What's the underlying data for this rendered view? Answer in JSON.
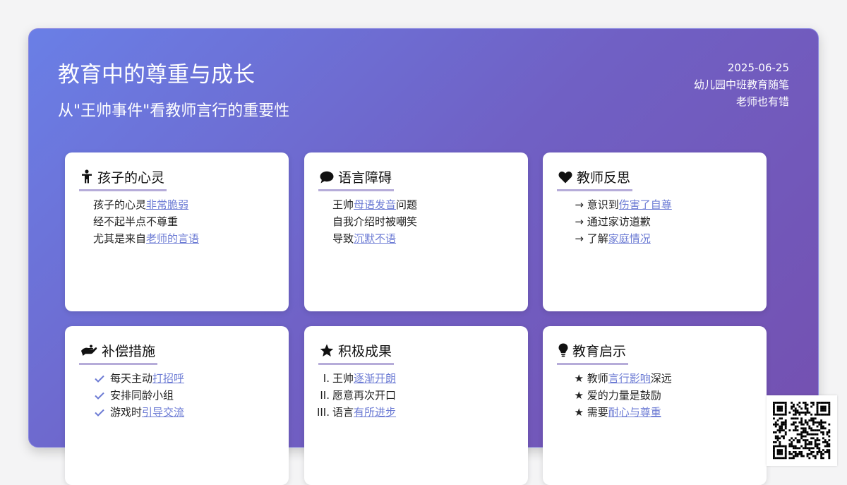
{
  "header": {
    "title": "教育中的尊重与成长",
    "subtitle": "从\"王帅事件\"看教师言行的重要性",
    "date": "2025-06-25",
    "category": "幼儿园中班教育随笔",
    "tag": "老师也有错"
  },
  "colors": {
    "gradient_start": "#6a7fe6",
    "gradient_end": "#7450b0",
    "highlight": "#6c7bd4",
    "underline": "#b6acd9"
  },
  "cards": [
    {
      "title": "孩子的心灵",
      "icon": "child-icon",
      "items": [
        {
          "lead": "",
          "pre": "孩子的心灵",
          "hl": "非常脆弱",
          "post": ""
        },
        {
          "lead": "",
          "pre": "经不起半点不尊重",
          "hl": "",
          "post": ""
        },
        {
          "lead": "",
          "pre": "尤其是来自",
          "hl": "老师的言语",
          "post": ""
        }
      ]
    },
    {
      "title": "语言障碍",
      "icon": "speech-bubble-icon",
      "items": [
        {
          "lead": "",
          "pre": "王帅",
          "hl": "母语发音",
          "post": "问题"
        },
        {
          "lead": "",
          "pre": "自我介绍时被嘲笑",
          "hl": "",
          "post": ""
        },
        {
          "lead": "",
          "pre": "导致",
          "hl": "沉默不语",
          "post": ""
        }
      ]
    },
    {
      "title": "教师反思",
      "icon": "heart-icon",
      "items": [
        {
          "lead": "→",
          "pre": " 意识到",
          "hl": "伤害了自尊",
          "post": ""
        },
        {
          "lead": "→",
          "pre": " 通过家访道歉",
          "hl": "",
          "post": ""
        },
        {
          "lead": "→",
          "pre": " 了解",
          "hl": "家庭情况",
          "post": ""
        }
      ]
    },
    {
      "title": "补偿措施",
      "icon": "hand-holding-icon",
      "items": [
        {
          "lead": "",
          "pre": "每天主动",
          "hl": "打招呼",
          "post": ""
        },
        {
          "lead": "",
          "pre": "安排同龄小组",
          "hl": "",
          "post": ""
        },
        {
          "lead": "",
          "pre": "游戏时",
          "hl": "引导交流",
          "post": ""
        }
      ]
    },
    {
      "title": "积极成果",
      "icon": "star-icon",
      "items": [
        {
          "lead": "I.",
          "pre": "王帅",
          "hl": "逐渐开朗",
          "post": ""
        },
        {
          "lead": "II.",
          "pre": "愿意再次开口",
          "hl": "",
          "post": ""
        },
        {
          "lead": "III.",
          "pre": "语言",
          "hl": "有所进步",
          "post": ""
        }
      ]
    },
    {
      "title": "教育启示",
      "icon": "lightbulb-icon",
      "items": [
        {
          "lead": "★",
          "pre": " 教师",
          "hl": "言行影响",
          "post": "深远"
        },
        {
          "lead": "★",
          "pre": " 爱的力量是鼓励",
          "hl": "",
          "post": ""
        },
        {
          "lead": "★",
          "pre": " 需要",
          "hl": "耐心与尊重",
          "post": ""
        }
      ]
    }
  ]
}
